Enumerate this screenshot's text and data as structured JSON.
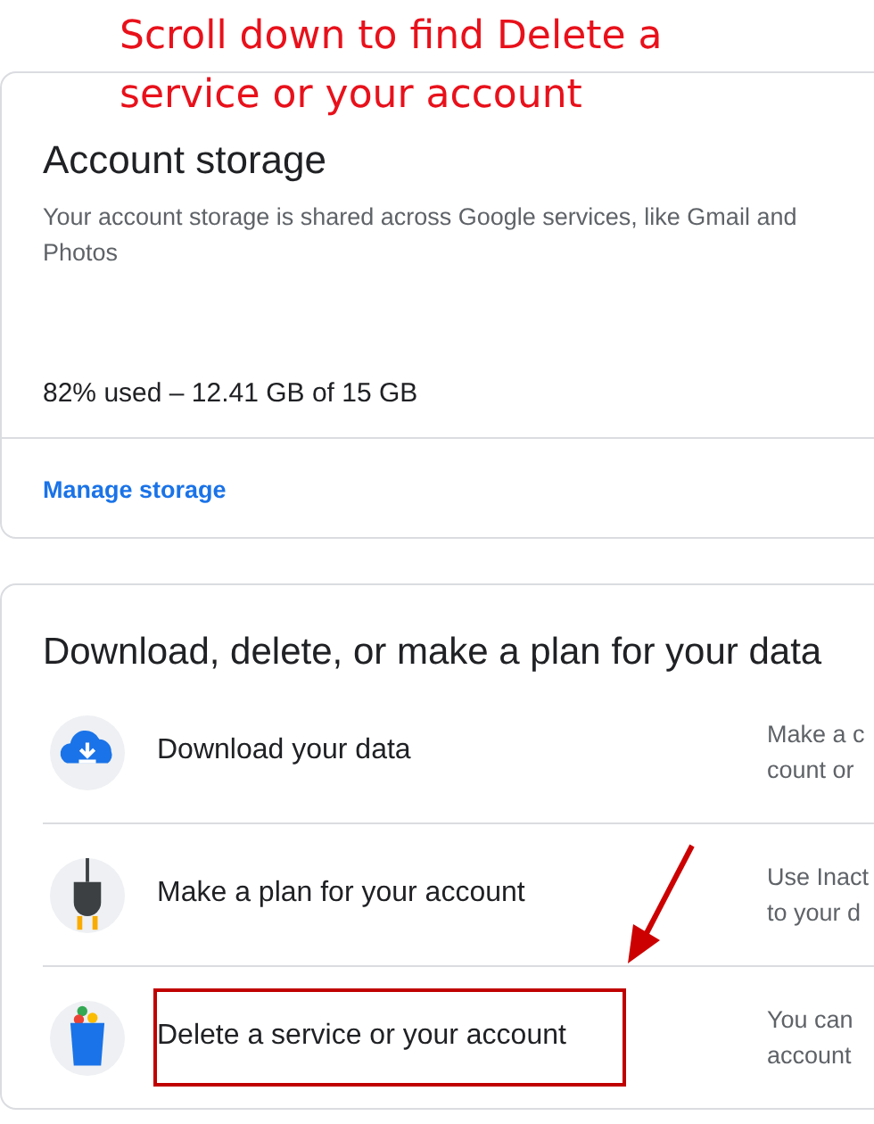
{
  "annotation": {
    "text": "Scroll down to find Delete a service or your account"
  },
  "storage_card": {
    "title": "Account storage",
    "description": "Your account storage is shared across Google services, like Gmail and Photos",
    "usage": "82% used – 12.41 GB of 15 GB",
    "link": "Manage storage"
  },
  "data_card": {
    "title": "Download, delete, or make a plan for your data",
    "rows": [
      {
        "kind": "download",
        "label": "Download your data",
        "description": [
          "Make a c",
          "count or"
        ],
        "highlighted": false
      },
      {
        "kind": "plan",
        "label": "Make a plan for your account",
        "description": [
          "Use Inact",
          "to your d"
        ],
        "highlighted": false
      },
      {
        "kind": "delete",
        "label": "Delete a service or your account",
        "description": [
          "You can",
          "account"
        ],
        "highlighted": true
      }
    ]
  }
}
